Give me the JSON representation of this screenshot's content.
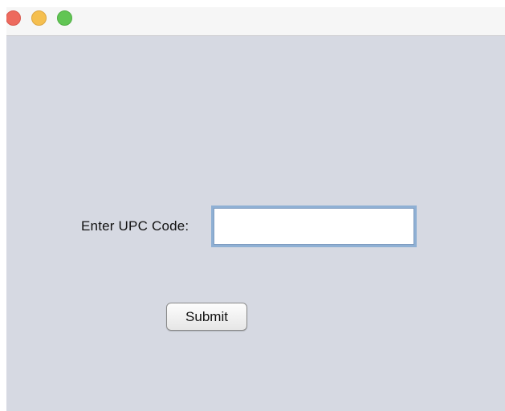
{
  "window": {
    "controls": {
      "close_color": "#ed6a5e",
      "minimize_color": "#f5bf4f",
      "zoom_color": "#61c554"
    },
    "background_color": "#d6d9e2"
  },
  "form": {
    "upc_label": "Enter UPC Code:",
    "upc_value": "",
    "submit_label": "Submit"
  }
}
